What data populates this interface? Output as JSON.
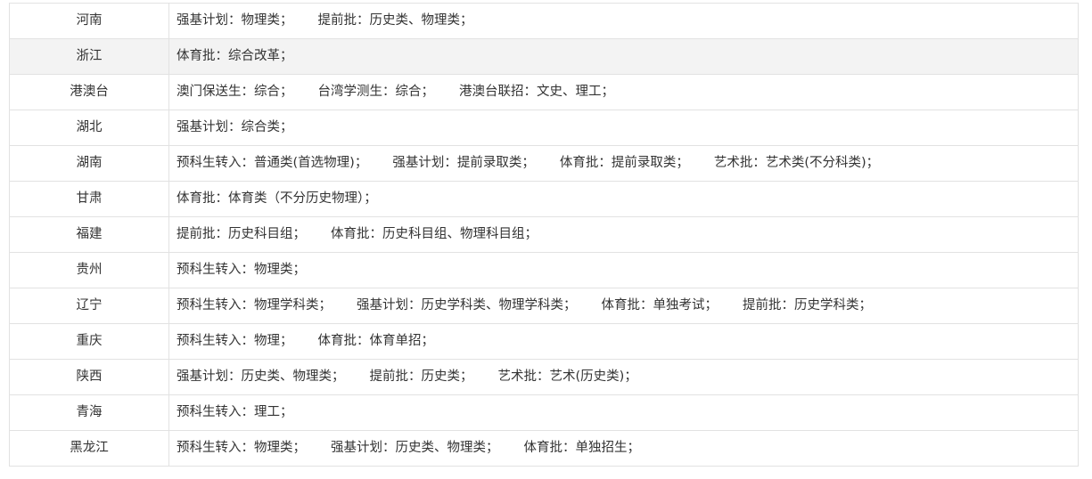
{
  "rows": [
    {
      "province": "河南",
      "entries": [
        "强基计划：物理类；",
        "提前批：历史类、物理类；"
      ]
    },
    {
      "province": "浙江",
      "entries": [
        "体育批：综合改革；"
      ]
    },
    {
      "province": "港澳台",
      "entries": [
        "澳门保送生：综合；",
        "台湾学测生：综合；",
        "港澳台联招：文史、理工；"
      ]
    },
    {
      "province": "湖北",
      "entries": [
        "强基计划：综合类；"
      ]
    },
    {
      "province": "湖南",
      "entries": [
        "预科生转入：普通类(首选物理)；",
        "强基计划：提前录取类；",
        "体育批：提前录取类；",
        "艺术批：艺术类(不分科类)；"
      ]
    },
    {
      "province": "甘肃",
      "entries": [
        "体育批：体育类（不分历史物理）；"
      ]
    },
    {
      "province": "福建",
      "entries": [
        "提前批：历史科目组；",
        "体育批：历史科目组、物理科目组；"
      ]
    },
    {
      "province": "贵州",
      "entries": [
        "预科生转入：物理类；"
      ]
    },
    {
      "province": "辽宁",
      "entries": [
        "预科生转入：物理学科类；",
        "强基计划：历史学科类、物理学科类；",
        "体育批：单独考试；",
        "提前批：历史学科类；"
      ]
    },
    {
      "province": "重庆",
      "entries": [
        "预科生转入：物理；",
        "体育批：体育单招；"
      ]
    },
    {
      "province": "陕西",
      "entries": [
        "强基计划：历史类、物理类；",
        "提前批：历史类；",
        "艺术批：艺术(历史类)；"
      ]
    },
    {
      "province": "青海",
      "entries": [
        "预科生转入：理工；"
      ]
    },
    {
      "province": "黑龙江",
      "entries": [
        "预科生转入：物理类；",
        "强基计划：历史类、物理类；",
        "体育批：单独招生；"
      ]
    }
  ]
}
